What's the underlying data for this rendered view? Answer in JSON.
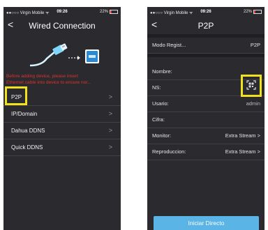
{
  "left": {
    "status": {
      "carrier": "●●○○○ Virgin Mobile ᯤ",
      "time": "09:26",
      "battery": "22%",
      "battery_level": 0.22
    },
    "nav": {
      "back": "<",
      "title": "Wired Connection"
    },
    "warning": [
      "Before adding device, please insert",
      "Ethernet cable into device to ensure nor..."
    ],
    "menu": [
      {
        "label": "P2P",
        "chevron": ">"
      },
      {
        "label": "IP/Domain",
        "chevron": ">"
      },
      {
        "label": "Dahua DDNS",
        "chevron": ">"
      },
      {
        "label": "Quick DDNS",
        "chevron": ">"
      }
    ]
  },
  "right": {
    "status": {
      "carrier": "●●○○○ Virgin Mobile ᯤ",
      "time": "09:26",
      "battery": "22%",
      "battery_level": 0.22
    },
    "nav": {
      "back": "<",
      "title": "P2P"
    },
    "mode": {
      "label": "Modo Regist...",
      "value": "P2P"
    },
    "fields": {
      "name_label": "Nombre:",
      "sn_label": "NS:",
      "user_label": "Usario:",
      "user_value": "admin",
      "password_label": "Cifra:",
      "monitor_label": "Monitor:",
      "monitor_value": "Extra Stream",
      "playback_label": "Reproduccion:",
      "playback_value": "Extra Stream",
      "chevron": ">"
    },
    "start_button": "Iniciar Directo"
  },
  "colors": {
    "highlight": "#f2e21e",
    "warning": "#e0312d",
    "accent": "#5ab4e6",
    "background": "#2b2b2f"
  },
  "icons": [
    "ethernet-cable-icon",
    "router-icon",
    "qr-scan-icon",
    "battery-icon"
  ]
}
